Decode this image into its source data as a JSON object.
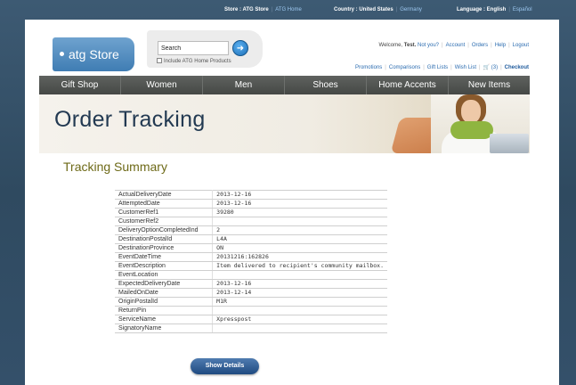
{
  "topbar": {
    "store_label": "Store : ATG Store",
    "store_link": "ATG Home",
    "country_label": "Country : United States",
    "country_link": "Germany",
    "language_label": "Language : English",
    "language_link": "Español"
  },
  "header": {
    "logo_text": "atg Store",
    "search": {
      "value": "Search",
      "button_icon": "arrow-right-icon",
      "include_label": "Include ATG Home Products"
    },
    "account": {
      "welcome_prefix": "Welcome,",
      "user_name": "Test.",
      "not_you": "Not you?",
      "account": "Account",
      "orders": "Orders",
      "help": "Help",
      "logout": "Logout"
    },
    "utility": {
      "promotions": "Promotions",
      "comparisons": "Comparisons",
      "gift_lists": "Gift Lists",
      "wish_list": "Wish List",
      "cart_count": "(3)",
      "checkout": "Checkout"
    }
  },
  "nav": {
    "items": [
      "Gift Shop",
      "Women",
      "Men",
      "Shoes",
      "Home Accents",
      "New Items"
    ]
  },
  "banner": {
    "title": "Order Tracking"
  },
  "summary": {
    "title": "Tracking Summary",
    "rows": [
      {
        "key": "ActualDeliveryDate",
        "value": "2013-12-16"
      },
      {
        "key": "AttemptedDate",
        "value": "2013-12-16"
      },
      {
        "key": "CustomerRef1",
        "value": "39280"
      },
      {
        "key": "CustomerRef2",
        "value": ""
      },
      {
        "key": "DeliveryOptionCompletedInd",
        "value": "2"
      },
      {
        "key": "DestinationPostalId",
        "value": "L4A"
      },
      {
        "key": "DestinationProvince",
        "value": "ON"
      },
      {
        "key": "EventDateTime",
        "value": "20131216:162826"
      },
      {
        "key": "EventDescription",
        "value": "Item delivered to recipient's community mailbox."
      },
      {
        "key": "EventLocation",
        "value": ""
      },
      {
        "key": "ExpectedDeliveryDate",
        "value": "2013-12-16"
      },
      {
        "key": "MailedOnDate",
        "value": "2013-12-14"
      },
      {
        "key": "OriginPostalId",
        "value": "M1R"
      },
      {
        "key": "ReturnPin",
        "value": ""
      },
      {
        "key": "ServiceName",
        "value": "Xpresspost"
      },
      {
        "key": "SignatoryName",
        "value": ""
      }
    ],
    "show_details_label": "Show Details"
  },
  "colors": {
    "background": "#34506a",
    "nav_bar": "#4f524f",
    "title_blue": "#233a52",
    "section_olive": "#6e6a18",
    "link_blue": "#2b6cb0"
  }
}
